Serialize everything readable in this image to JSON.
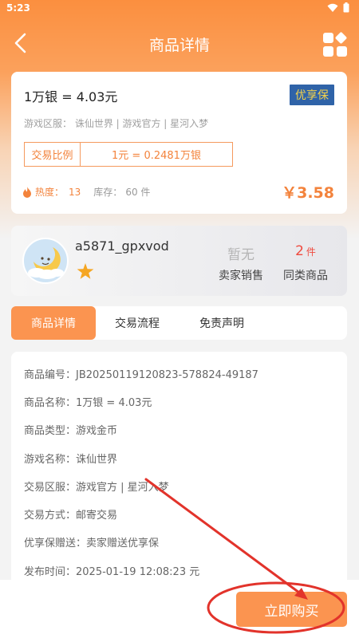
{
  "status_bar": {
    "time": "5:23"
  },
  "nav": {
    "title": "商品详情"
  },
  "product": {
    "title": "1万银 = 4.03元",
    "badge": "优享保",
    "server_line": "游戏区服：  诛仙世界 | 游戏官方 | 星河入梦",
    "ratio_label": "交易比例",
    "ratio_value": "1元 = 0.2481万银",
    "heat_label": "热度：",
    "heat_value": "13",
    "stock_label": "库存：",
    "stock_value": "60 件",
    "price": "￥3.58"
  },
  "seller": {
    "name": "a5871_gpxvod",
    "rating_stars": 1,
    "sales_value": "暂无",
    "sales_label": "卖家销售",
    "similar_value": "2",
    "similar_unit": "件",
    "similar_label": "同类商品"
  },
  "tabs": [
    {
      "label": "商品详情",
      "active": true
    },
    {
      "label": "交易流程",
      "active": false
    },
    {
      "label": "免责声明",
      "active": false
    }
  ],
  "details": [
    {
      "label": "商品编号：",
      "value": "JB20250119120823-578824-49187"
    },
    {
      "label": "商品名称：",
      "value": "1万银 = 4.03元"
    },
    {
      "label": "商品类型：",
      "value": "游戏金币"
    },
    {
      "label": "游戏名称：",
      "value": "诛仙世界"
    },
    {
      "label": "交易区服：",
      "value": "游戏官方 | 星河入梦"
    },
    {
      "label": "交易方式：",
      "value": "邮寄交易"
    },
    {
      "label": "优享保赠送：",
      "value": "卖家赠送优享保"
    },
    {
      "label": "发布时间：",
      "value": "2025-01-19 12:08:23 元"
    }
  ],
  "bottom": {
    "buy_label": "立即购买"
  },
  "colors": {
    "accent": "#fb9450",
    "price": "#f3833c",
    "badge_bg": "#2f63a8",
    "badge_text": "#f4d24a",
    "annotation": "#e2332b"
  }
}
